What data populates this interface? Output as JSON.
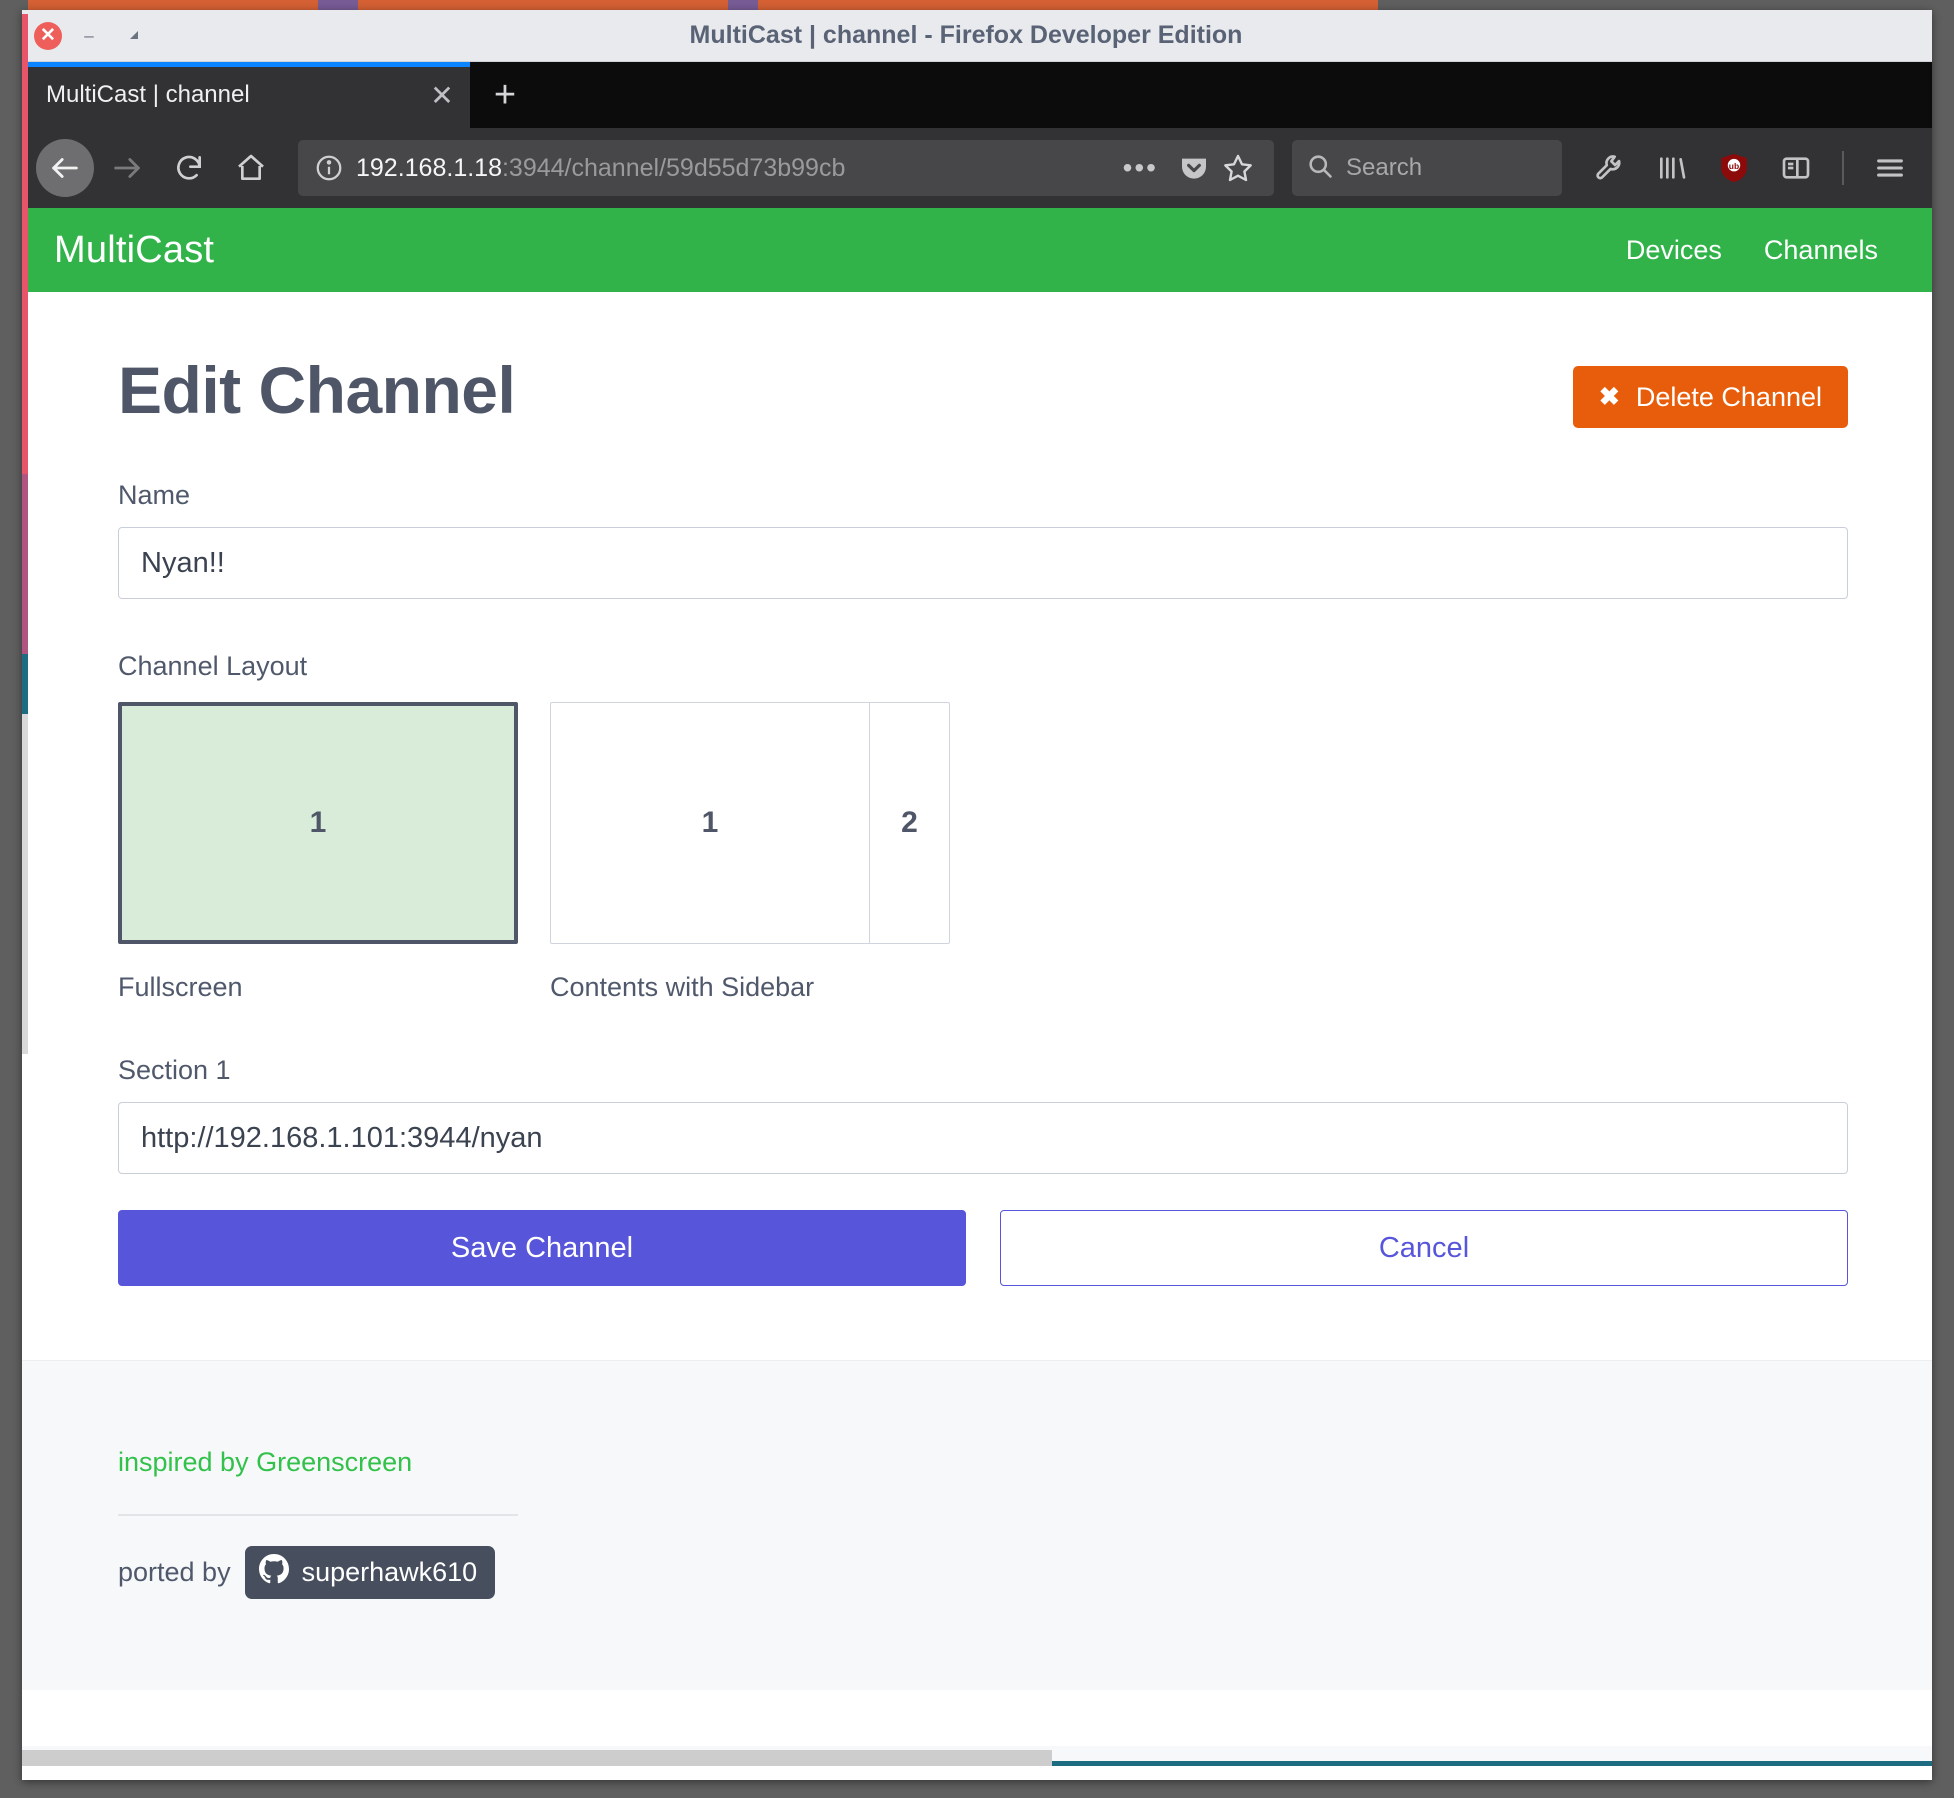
{
  "window": {
    "title": "MultiCast | channel - Firefox Developer Edition",
    "close_icon": "close-icon",
    "minimize_icon": "minimize-icon",
    "maximize_icon": "maximize-icon"
  },
  "browser": {
    "tab": {
      "label": "MultiCast | channel",
      "close_label": "✕"
    },
    "new_tab_label": "+",
    "toolbar": {
      "back_icon": "back-arrow-icon",
      "forward_icon": "forward-arrow-icon",
      "reload_icon": "reload-icon",
      "home_icon": "home-icon",
      "page_actions_label": "•••",
      "pocket_icon": "pocket-icon",
      "bookmark_icon": "star-icon",
      "devtools_icon": "wrench-icon",
      "library_icon": "library-icon",
      "ublock_icon": "ublock-origin-icon",
      "sidebar_icon": "sidebar-icon",
      "menu_icon": "hamburger-menu-icon"
    },
    "url": {
      "host": "192.168.1.18",
      "path": ":3944/channel/59d55d73b99cb",
      "identity_icon": "info-circle-icon"
    },
    "search": {
      "placeholder": "Search",
      "icon": "search-icon"
    }
  },
  "site_nav": {
    "brand": "MultiCast",
    "links": [
      {
        "label": "Devices"
      },
      {
        "label": "Channels"
      }
    ],
    "accent_color": "#32b34a"
  },
  "main": {
    "title": "Edit Channel",
    "delete_button": {
      "label": "Delete Channel",
      "icon": "✖",
      "color": "#e85d0b"
    },
    "name_field": {
      "label": "Name",
      "value": "Nyan!!"
    },
    "layout_field": {
      "label": "Channel Layout",
      "options": [
        {
          "caption": "Fullscreen",
          "cells": [
            "1"
          ],
          "selected": true
        },
        {
          "caption": "Contents with Sidebar",
          "cells": [
            "1",
            "2"
          ],
          "selected": false
        }
      ]
    },
    "section_fields": [
      {
        "label": "Section 1",
        "value": "http://192.168.1.101:3944/nyan"
      }
    ],
    "save_button": {
      "label": "Save Channel",
      "color": "#5755d9"
    },
    "cancel_button": {
      "label": "Cancel",
      "color": "#5755d9"
    }
  },
  "footer": {
    "inspired_link": "inspired by Greenscreen",
    "ported_prefix": "ported by",
    "github_user": "superhawk610",
    "github_icon": "github-icon"
  }
}
